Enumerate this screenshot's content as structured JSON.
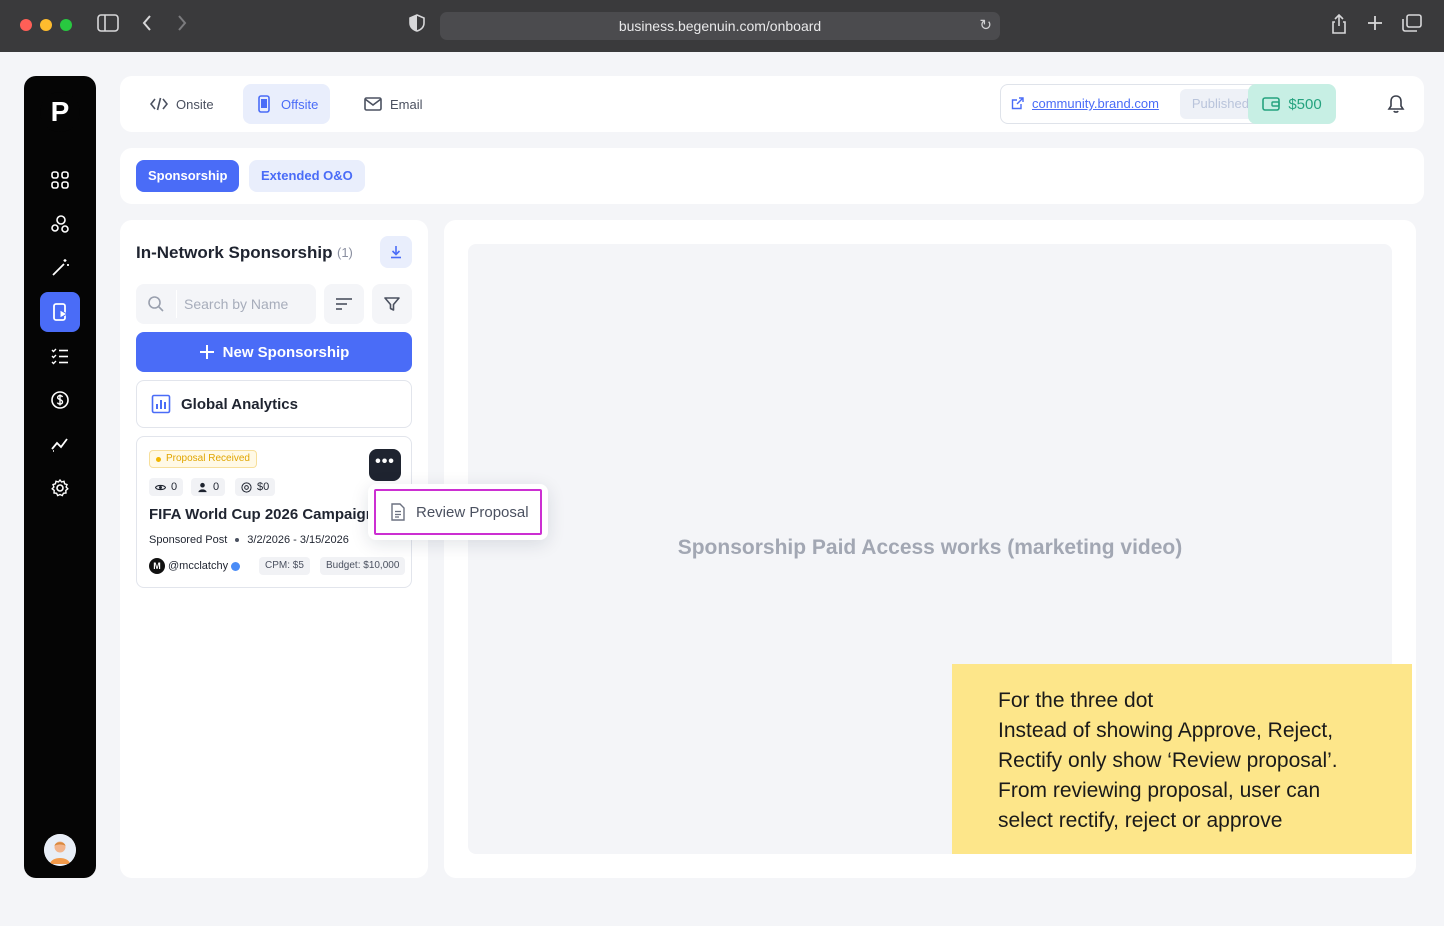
{
  "browser": {
    "url": "business.begenuin.com/onboard"
  },
  "sidebar": {
    "logo_letter": "P",
    "items": [
      {
        "icon": "grid-icon"
      },
      {
        "icon": "community-icon"
      },
      {
        "icon": "magic-wand-icon"
      },
      {
        "icon": "sponsorship-icon",
        "active": true
      },
      {
        "icon": "checklist-icon"
      },
      {
        "icon": "dollar-icon"
      },
      {
        "icon": "trend-icon"
      },
      {
        "icon": "settings-icon"
      }
    ]
  },
  "topbar": {
    "tabs": [
      {
        "label": "Onsite",
        "icon": "code-icon"
      },
      {
        "label": "Offsite",
        "icon": "mobile-icon",
        "active": true
      },
      {
        "label": "Email",
        "icon": "mail-icon"
      }
    ],
    "community_link": "community.brand.com",
    "publish_status": "Published",
    "wallet_amount": "$500"
  },
  "subtabs": {
    "items": [
      {
        "label": "Sponsorship",
        "active": true
      },
      {
        "label": "Extended O&O"
      }
    ]
  },
  "left_panel": {
    "title": "In-Network Sponsorship",
    "count": "(1)",
    "search_placeholder": "Search by Name",
    "new_button": "New Sponsorship",
    "analytics_label": "Global Analytics",
    "card": {
      "status": "Proposal Received",
      "views": "0",
      "users": "0",
      "earnings": "$0",
      "title": "FIFA World Cup 2026 Campaign",
      "type": "Sponsored Post",
      "dates": "3/2/2026 - 3/15/2026",
      "handle_initial": "M",
      "handle": "@mcclatchy",
      "cpm": "CPM: $5",
      "budget": "Budget: $10,000"
    }
  },
  "dropdown": {
    "review_label": "Review Proposal"
  },
  "main": {
    "video_placeholder": "Sponsorship Paid Access works (marketing video)"
  },
  "note": {
    "lines": [
      "For the three dot",
      "Instead of showing Approve, Reject,",
      "Rectify only show ‘Review proposal’.",
      "From reviewing proposal, user can",
      "select rectify, reject or approve"
    ]
  },
  "colors": {
    "accent": "#4a6cf7",
    "sidebar": "#050505",
    "note": "#fde68a",
    "highlight": "#cc2fd2",
    "wallet": "#25a37f"
  }
}
